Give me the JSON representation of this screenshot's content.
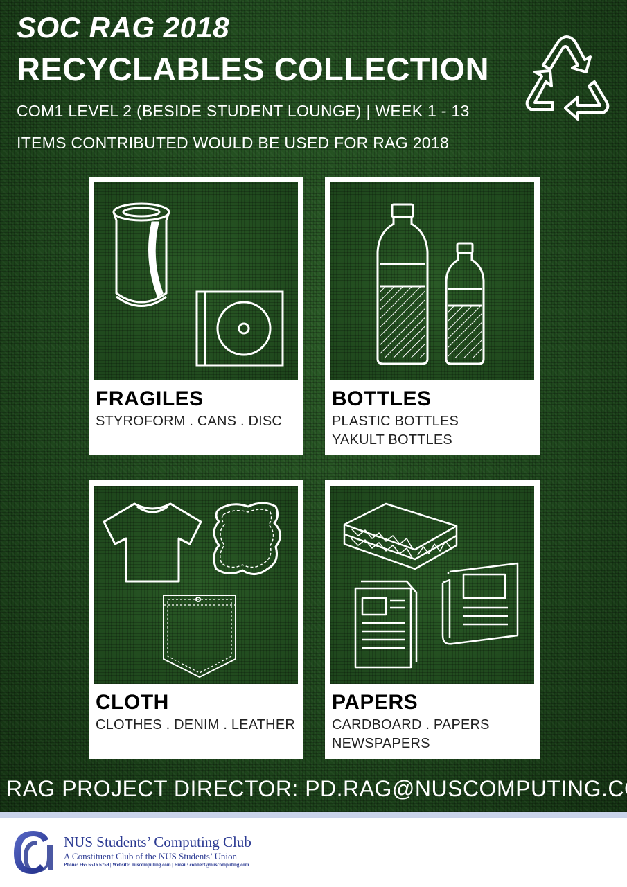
{
  "header": {
    "title": "SOC RAG 2018",
    "subtitle": "RECYCLABLES COLLECTION",
    "location": "COM1 LEVEL 2 (BESIDE STUDENT LOUNGE) | WEEK 1 - 13",
    "note": "ITEMS CONTRIBUTED WOULD BE USED FOR RAG 2018",
    "icon": "recycle-icon"
  },
  "categories": [
    {
      "title": "FRAGILES",
      "line1": "STYROFORM . CANS . DISC",
      "line2": "",
      "icons": [
        "can-icon",
        "disc-icon"
      ]
    },
    {
      "title": "BOTTLES",
      "line1": "PLASTIC BOTTLES",
      "line2": "YAKULT BOTTLES",
      "icons": [
        "bottle-icon"
      ]
    },
    {
      "title": "CLOTH",
      "line1": "CLOTHES . DENIM . LEATHER",
      "line2": "",
      "icons": [
        "tshirt-icon",
        "leather-icon",
        "pocket-icon"
      ]
    },
    {
      "title": "PAPERS",
      "line1": "CARDBOARD . PAPERS",
      "line2": "NEWSPAPERS",
      "icons": [
        "cardboard-icon",
        "document-icon",
        "newspaper-icon"
      ]
    }
  ],
  "contact": "RAG PROJECT DIRECTOR: PD.RAG@NUSCOMPUTING.COM",
  "footer": {
    "club_name": "NUS Students’ Computing Club",
    "club_sub": "A Constituent Club of the NUS Students’ Union",
    "club_contact": "Phone: +65 6516 6759   |  Website: nuscomputing.com  | Email: connect@nuscomputing.com"
  },
  "colors": {
    "background": "#1f4a1d",
    "card": "#ffffff",
    "footer_stripe": "#c9d3ea",
    "club_blue": "#2c3b93"
  }
}
